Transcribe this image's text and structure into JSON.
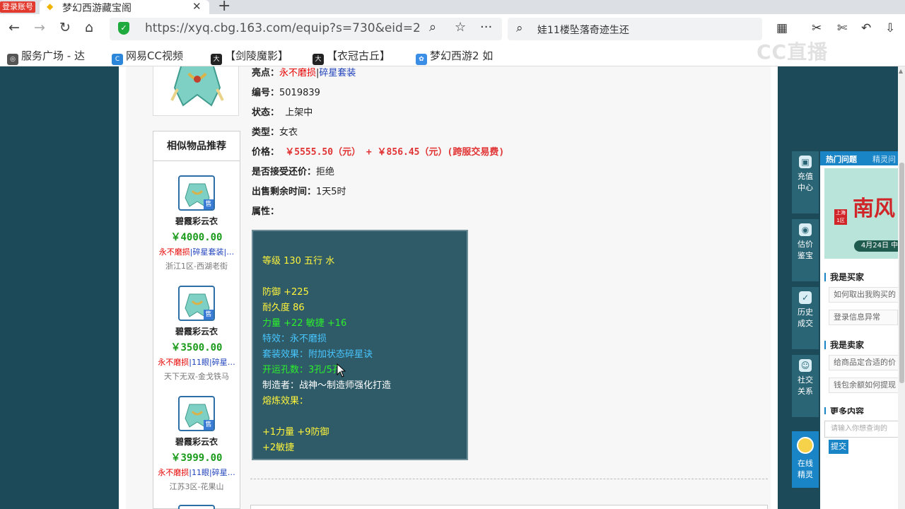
{
  "browser": {
    "login_badge": "登录账号",
    "tab_title": "梦幻西游藏宝阁",
    "url": "https://xyq.cbg.163.com/equip?s=730&eid=2",
    "search_text": "娃11楼坠落奇迹生还",
    "watermark": "CC直播",
    "bookmarks": [
      {
        "label": "服务广场 - 达"
      },
      {
        "label": "网易CC视频"
      },
      {
        "label": "【剑陵魔影】"
      },
      {
        "label": "【衣冠古丘】"
      },
      {
        "label": "梦幻西游2 如"
      }
    ]
  },
  "item": {
    "highlight_label": "亮点：",
    "highlight_red": "永不磨损",
    "highlight_sep": "|",
    "highlight_blue": "碎星套装",
    "id_label": "编号：",
    "id_value": "5019839",
    "status_label": "状态：",
    "status_value": "上架中",
    "type_label": "类型：",
    "type_value": "女衣",
    "price_label": "价格：",
    "price_value": "￥5555.50（元） +  ￥856.45（元）(跨服交易费)",
    "bargain_label": "是否接受还价：",
    "bargain_value": "拒绝",
    "remaining_label": "出售剩余时间：",
    "remaining_value": "1天5时",
    "attr_label": "属性："
  },
  "attributes": {
    "level": "等级 130 五行 水",
    "defense": "防御 +225",
    "durability": "耐久度 86",
    "strength_agility": "力量 +22 敏捷 +16",
    "effect": "特效：永不磨损",
    "set_effect": "套装效果：附加状态碎星诀",
    "sockets": "开运孔数：3孔/5孔",
    "maker": "制造者：战神～制造师强化打造",
    "refine_label": "熔炼效果：",
    "refine_1": "+1力量 +9防御",
    "refine_2": "+2敏捷"
  },
  "recommend": {
    "title": "相似物品推荐",
    "sell_tag": "售",
    "items": [
      {
        "name": "碧霞彩云衣",
        "price": "￥4000.00",
        "tag_red": "永不磨损",
        "tag_rest": "|碎星套装|…",
        "server": "浙江1区-西湖老街"
      },
      {
        "name": "碧霞彩云衣",
        "price": "￥3500.00",
        "tag_red": "永不磨损",
        "tag_rest": "|11眼|碎星…",
        "server": "天下无双-金戈铁马"
      },
      {
        "name": "碧霞彩云衣",
        "price": "￥3999.00",
        "tag_red": "永不磨损",
        "tag_rest": "|11眼|碎星…",
        "server": "江苏3区-花果山"
      }
    ]
  },
  "side": {
    "buttons": [
      {
        "line1": "充值",
        "line2": "中心"
      },
      {
        "line1": "估价",
        "line2": "鉴宝"
      },
      {
        "line1": "历史",
        "line2": "成交"
      },
      {
        "line1": "社交",
        "line2": "关系"
      },
      {
        "line1": "在线",
        "line2": "精灵"
      }
    ]
  },
  "help": {
    "tab_hot": "热门问题",
    "tab_sprite": "精灵问",
    "banner_big": "南风",
    "banner_tag": "上海1区",
    "banner_date": "4月24日 中",
    "buyer_title": "我是买家",
    "buyer_q1": "如何取出我购买的",
    "buyer_q2": "登录信息异常",
    "seller_title": "我是卖家",
    "seller_q1": "给商品定合适的价",
    "seller_q2": "钱包余额如何提现",
    "more_title": "更多内容",
    "ask_placeholder": "请输入你想查询的",
    "submit": "提交"
  }
}
